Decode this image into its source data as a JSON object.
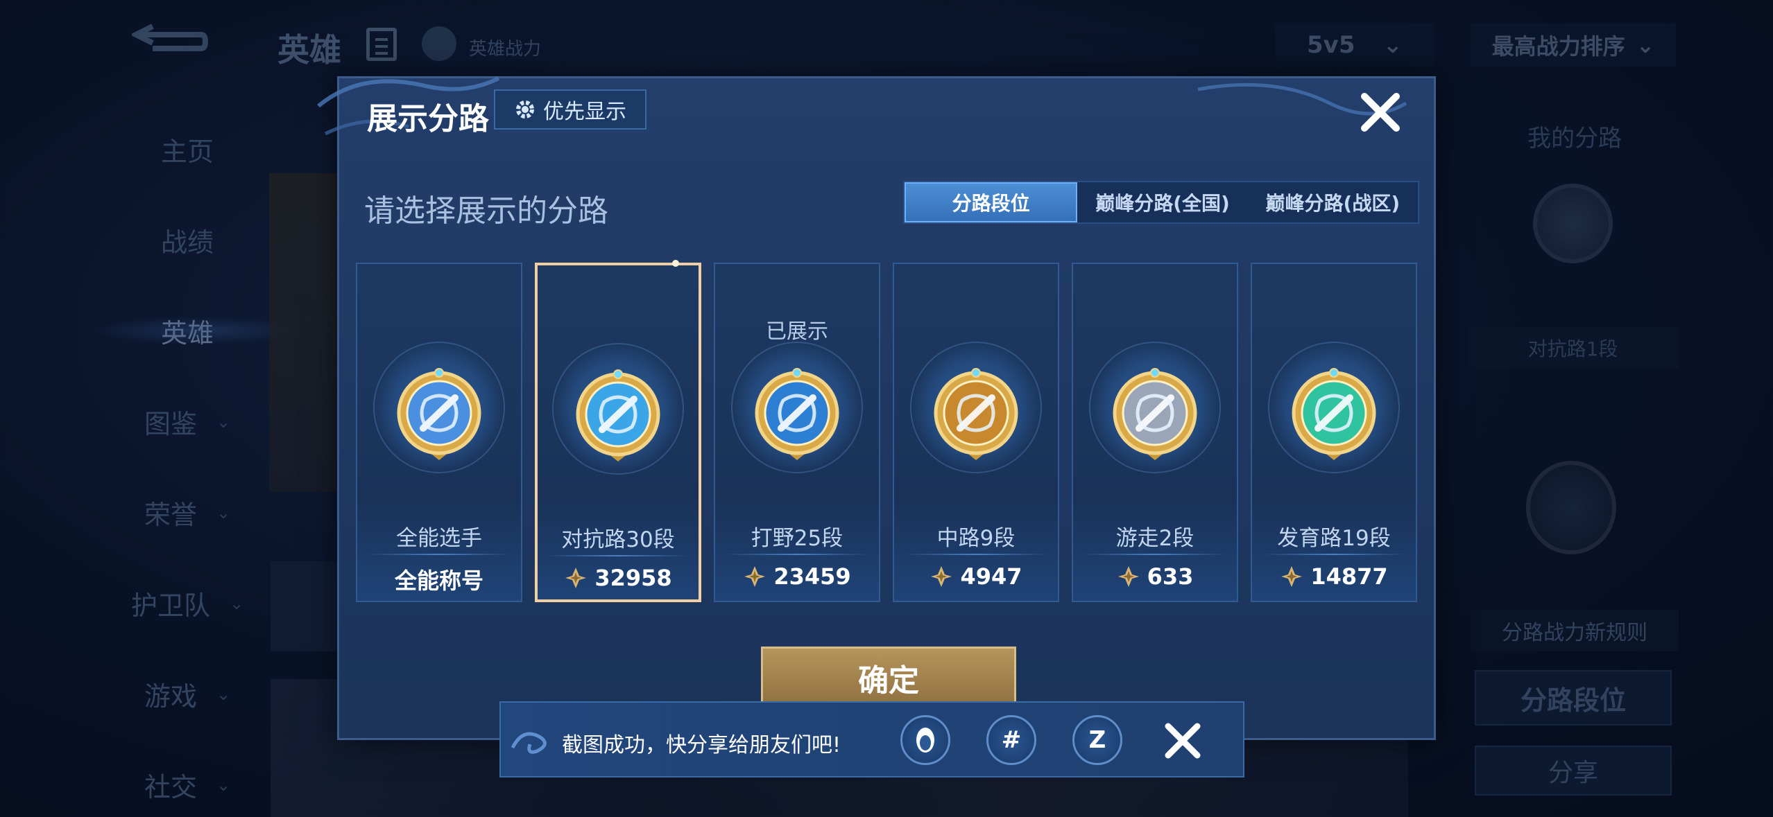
{
  "background": {
    "page_title": "英雄",
    "power_label": "英雄战力",
    "mode_select": "5v5",
    "sort_select": "最高战力排序",
    "nav": [
      {
        "label": "主页",
        "chevron": false,
        "active": false
      },
      {
        "label": "战绩",
        "chevron": false,
        "active": false
      },
      {
        "label": "英雄",
        "chevron": false,
        "active": true
      },
      {
        "label": "图鉴",
        "chevron": true,
        "active": false
      },
      {
        "label": "荣誉",
        "chevron": true,
        "active": false
      },
      {
        "label": "护卫队",
        "chevron": true,
        "active": false
      },
      {
        "label": "游戏",
        "chevron": true,
        "active": false
      },
      {
        "label": "社交",
        "chevron": true,
        "active": false
      }
    ],
    "right_panel": {
      "my_lane": "我的分路",
      "rank": "对抗路1段",
      "rule_button": "分路战力新规则",
      "lane_rank_button": "分路段位",
      "share_button": "分享"
    }
  },
  "dialog": {
    "title": "展示分路",
    "priority_button": "优先显示",
    "subtitle": "请选择展示的分路",
    "tabs": [
      {
        "label": "分路段位",
        "active": true
      },
      {
        "label": "巅峰分路(全国)",
        "active": false
      },
      {
        "label": "巅峰分路(战区)",
        "active": false
      }
    ],
    "cards": [
      {
        "name": "全能选手",
        "value": "全能称号",
        "show_power_icon": false,
        "shown_label": "",
        "selected": false,
        "emblem": "allround-emblem-icon",
        "accent": "#4a8fe0"
      },
      {
        "name": "对抗路30段",
        "value": "32958",
        "show_power_icon": true,
        "shown_label": "",
        "selected": true,
        "emblem": "clash-lane-emblem-icon",
        "accent": "#3aa6e8"
      },
      {
        "name": "打野25段",
        "value": "23459",
        "show_power_icon": true,
        "shown_label": "已展示",
        "selected": false,
        "emblem": "jungle-emblem-icon",
        "accent": "#2d7fd4"
      },
      {
        "name": "中路9段",
        "value": "4947",
        "show_power_icon": true,
        "shown_label": "",
        "selected": false,
        "emblem": "mid-lane-emblem-icon",
        "accent": "#c8892e"
      },
      {
        "name": "游走2段",
        "value": "633",
        "show_power_icon": true,
        "shown_label": "",
        "selected": false,
        "emblem": "roam-emblem-icon",
        "accent": "#9aa6b8"
      },
      {
        "name": "发育路19段",
        "value": "14877",
        "show_power_icon": true,
        "shown_label": "",
        "selected": false,
        "emblem": "farm-lane-emblem-icon",
        "accent": "#2fc3a0"
      }
    ],
    "confirm_button": "确定"
  },
  "toast": {
    "message": "截图成功，快分享给朋友们吧!",
    "share_targets": [
      "qq-share-icon",
      "moments-share-icon",
      "qzone-share-icon"
    ],
    "share_glyphs": [
      "",
      "#",
      "Z"
    ]
  }
}
